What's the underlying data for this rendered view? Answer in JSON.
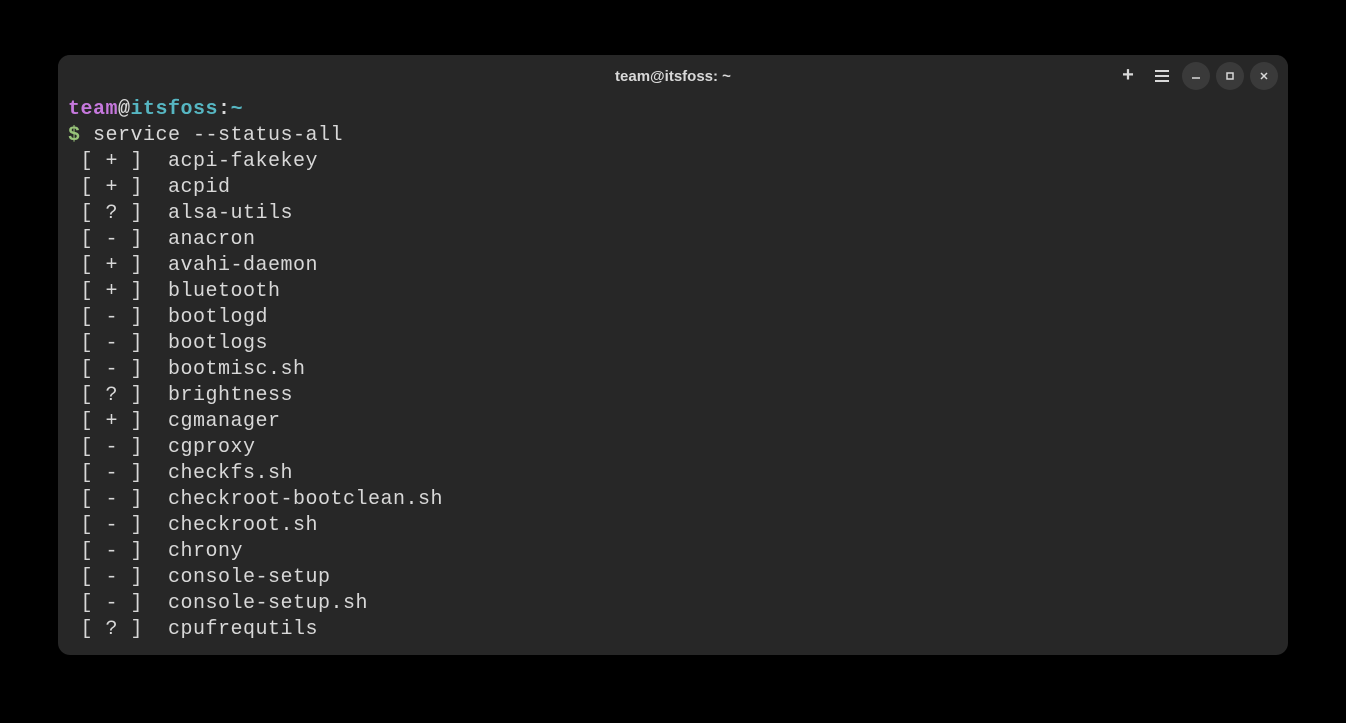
{
  "titlebar": {
    "title": "team@itsfoss: ~"
  },
  "prompt": {
    "user": "team",
    "at": "@",
    "host": "itsfoss",
    "colon": ":",
    "path": "~",
    "dollar": "$ ",
    "command": "service --status-all"
  },
  "services": [
    {
      "status": "+",
      "name": "acpi-fakekey"
    },
    {
      "status": "+",
      "name": "acpid"
    },
    {
      "status": "?",
      "name": "alsa-utils"
    },
    {
      "status": "-",
      "name": "anacron"
    },
    {
      "status": "+",
      "name": "avahi-daemon"
    },
    {
      "status": "+",
      "name": "bluetooth"
    },
    {
      "status": "-",
      "name": "bootlogd"
    },
    {
      "status": "-",
      "name": "bootlogs"
    },
    {
      "status": "-",
      "name": "bootmisc.sh"
    },
    {
      "status": "?",
      "name": "brightness"
    },
    {
      "status": "+",
      "name": "cgmanager"
    },
    {
      "status": "-",
      "name": "cgproxy"
    },
    {
      "status": "-",
      "name": "checkfs.sh"
    },
    {
      "status": "-",
      "name": "checkroot-bootclean.sh"
    },
    {
      "status": "-",
      "name": "checkroot.sh"
    },
    {
      "status": "-",
      "name": "chrony"
    },
    {
      "status": "-",
      "name": "console-setup"
    },
    {
      "status": "-",
      "name": "console-setup.sh"
    },
    {
      "status": "?",
      "name": "cpufrequtils"
    }
  ]
}
